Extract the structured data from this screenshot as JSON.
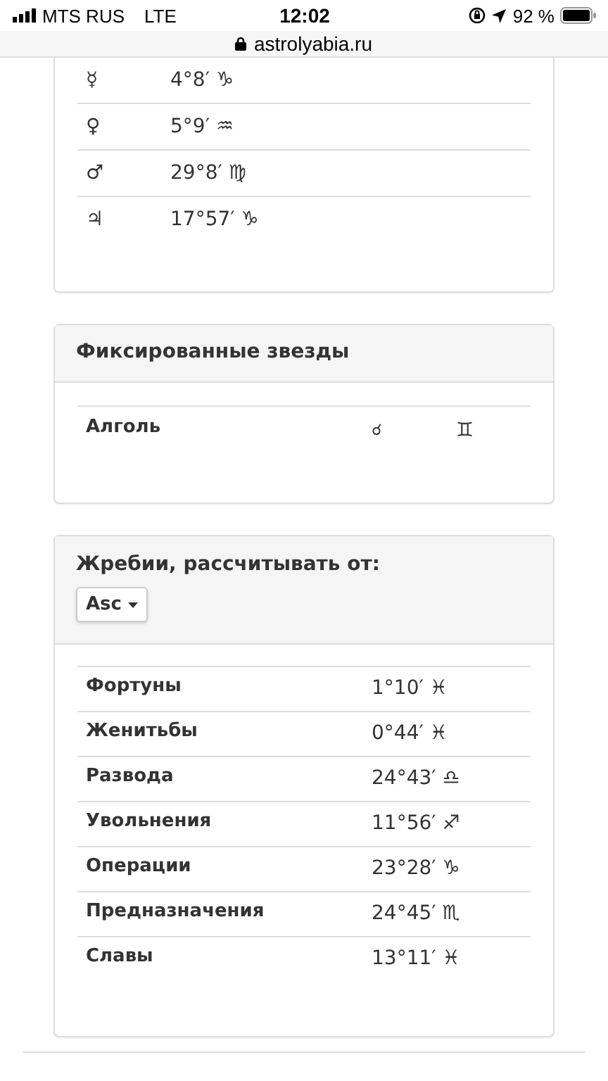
{
  "status_bar": {
    "carrier": "MTS RUS",
    "network": "LTE",
    "time": "12:02",
    "battery": "92 %"
  },
  "address_bar": {
    "url": "astrolyabia.ru"
  },
  "planets": [
    {
      "symbol": "☿",
      "position": "4°8′ ♑"
    },
    {
      "symbol": "♀",
      "position": "5°9′ ♒"
    },
    {
      "symbol": "♂",
      "position": "29°8′ ♍"
    },
    {
      "symbol": "♃",
      "position": "17°57′ ♑"
    }
  ],
  "fixed_stars": {
    "title": "Фиксированные звезды",
    "rows": [
      {
        "name": "Алголь",
        "aspect": "☌",
        "sign": "♊"
      }
    ]
  },
  "lots": {
    "title": "Жребии, рассчитывать от:",
    "dropdown": "Asc",
    "rows": [
      {
        "name": "Фортуны",
        "position": "1°10′ ♓"
      },
      {
        "name": "Женитьбы",
        "position": "0°44′ ♓"
      },
      {
        "name": "Развода",
        "position": "24°43′ ♎"
      },
      {
        "name": "Увольнения",
        "position": "11°56′ ♐"
      },
      {
        "name": "Операции",
        "position": "23°28′ ♑"
      },
      {
        "name": "Предназначения",
        "position": "24°45′ ♏"
      },
      {
        "name": "Славы",
        "position": "13°11′ ♓"
      }
    ]
  }
}
